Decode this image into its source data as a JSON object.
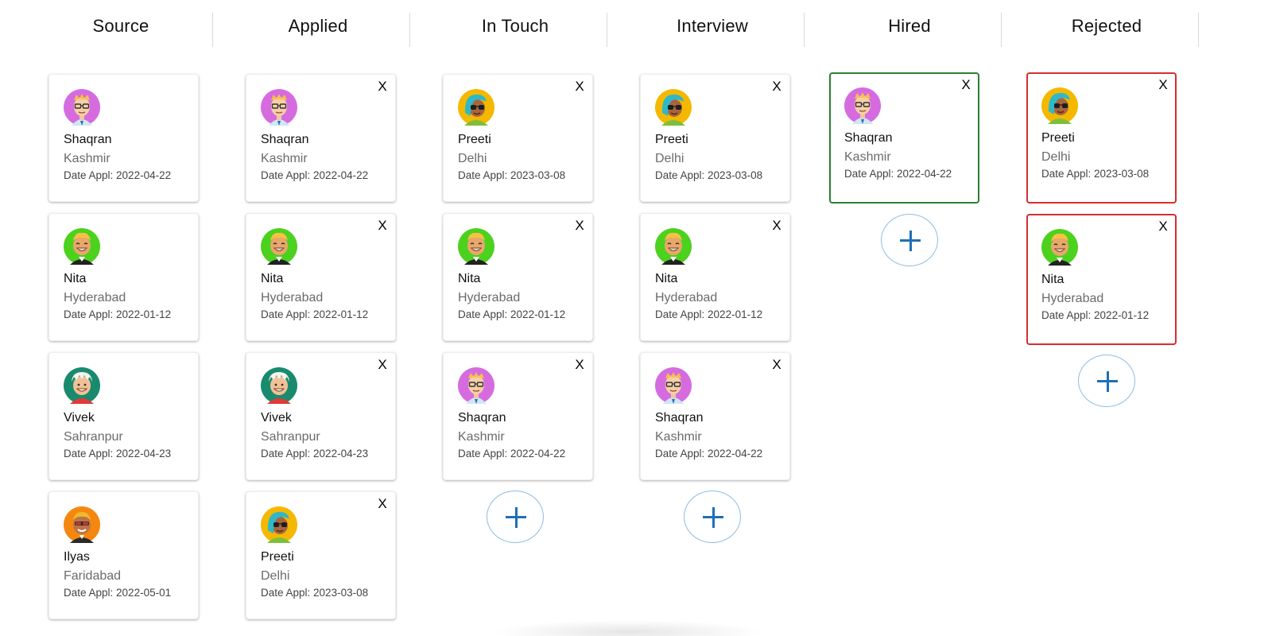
{
  "columns": [
    {
      "title": "Source"
    },
    {
      "title": "Applied"
    },
    {
      "title": "In Touch"
    },
    {
      "title": "Interview"
    },
    {
      "title": "Hired"
    },
    {
      "title": "Rejected"
    }
  ],
  "candidates": {
    "shaqran": {
      "name": "Shaqran",
      "city": "Kashmir",
      "date": "Date Appl: 2022-04-22"
    },
    "nita": {
      "name": "Nita",
      "city": "Hyderabad",
      "date": "Date Appl: 2022-01-12"
    },
    "vivek": {
      "name": "Vivek",
      "city": "Sahranpur",
      "date": "Date Appl: 2022-04-23"
    },
    "ilyas": {
      "name": "Ilyas",
      "city": "Faridabad",
      "date": "Date Appl: 2022-05-01"
    },
    "preeti": {
      "name": "Preeti",
      "city": "Delhi",
      "date": "Date Appl: 2023-03-08"
    }
  },
  "close_label": "X",
  "colors": {
    "hired_border": "#2e7d32",
    "rejected_border": "#d32f2f",
    "add_button_accent": "#1e6fb8"
  }
}
